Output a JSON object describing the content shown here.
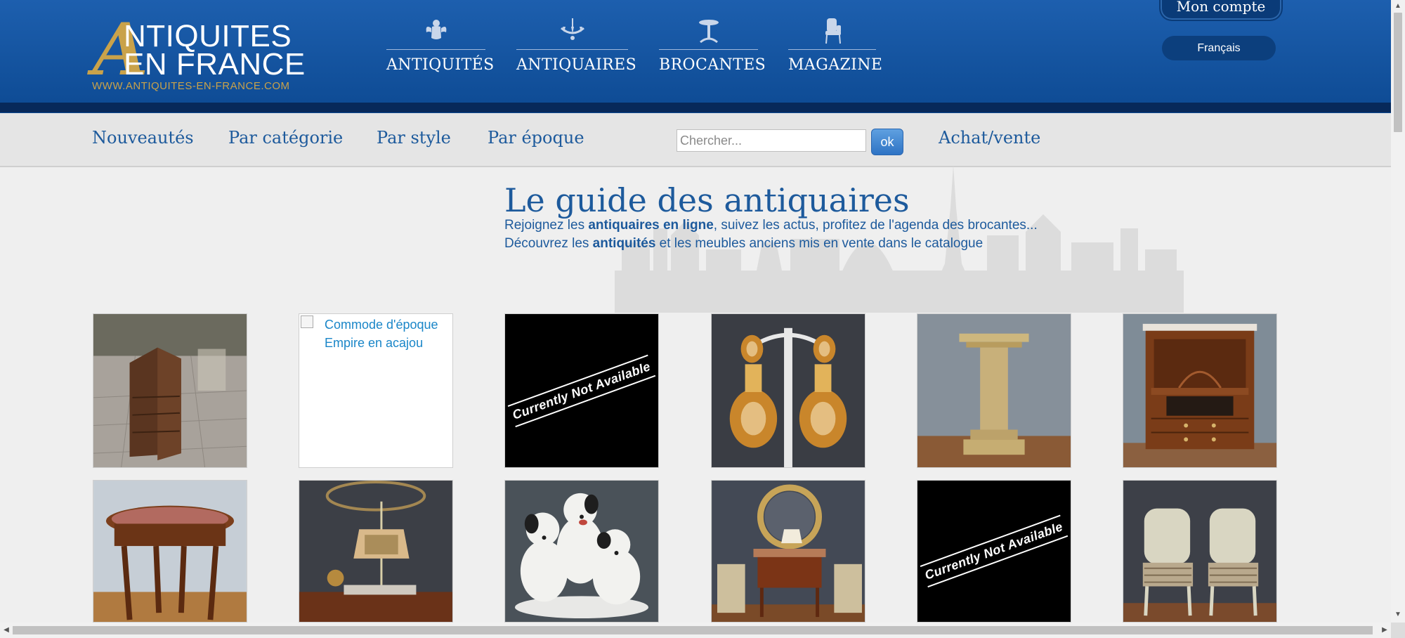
{
  "brand": {
    "logo_letter": "A",
    "logo_line1": "NTIQUITES",
    "logo_line2": "EN FRANCE",
    "logo_url": "WWW.ANTIQUITES-EN-FRANCE.COM",
    "gold_color": "#c9a24a",
    "header_blue": "#0d4a93"
  },
  "main_nav": [
    {
      "label": "ANTIQUITÉS",
      "icon": "cherub-icon"
    },
    {
      "label": "ANTIQUAIRES",
      "icon": "chandelier-icon"
    },
    {
      "label": "BROCANTES",
      "icon": "pedestal-table-icon"
    },
    {
      "label": "MAGAZINE",
      "icon": "armchair-icon"
    }
  ],
  "account": {
    "label": "Mon compte",
    "language": "Français"
  },
  "subnav": {
    "links": [
      "Nouveautés",
      "Par catégorie",
      "Par style",
      "Par époque"
    ],
    "search_placeholder": "Chercher...",
    "search_button": "ok",
    "achat": "Achat/vente",
    "link_color": "#1d5a9c"
  },
  "hero": {
    "title": "Le guide des antiquaires",
    "line1_a": "Rejoignez les ",
    "line1_b": "antiquaires en ligne",
    "line1_c": ", suivez les actus, profitez de l'agenda des brocantes...",
    "line2_a": "Découvrez les ",
    "line2_b": "antiquités",
    "line2_c": " et les meubles anciens mis en vente dans le catalogue"
  },
  "products": [
    {
      "kind": "image",
      "subject": "secretary-desk"
    },
    {
      "kind": "broken",
      "alt": "Commode d'époque Empire en acajou"
    },
    {
      "kind": "unavailable",
      "text": "Currently Not Available"
    },
    {
      "kind": "image",
      "subject": "cameo-earrings"
    },
    {
      "kind": "image",
      "subject": "marble-column"
    },
    {
      "kind": "image",
      "subject": "empire-secretaire"
    },
    {
      "kind": "image",
      "subject": "oval-side-table"
    },
    {
      "kind": "image",
      "subject": "bouillotte-lamp"
    },
    {
      "kind": "image",
      "subject": "porcelain-dogs"
    },
    {
      "kind": "image",
      "subject": "mirror-console"
    },
    {
      "kind": "unavailable",
      "text": "Currently Not Available"
    },
    {
      "kind": "image",
      "subject": "pair-of-armchairs"
    }
  ]
}
